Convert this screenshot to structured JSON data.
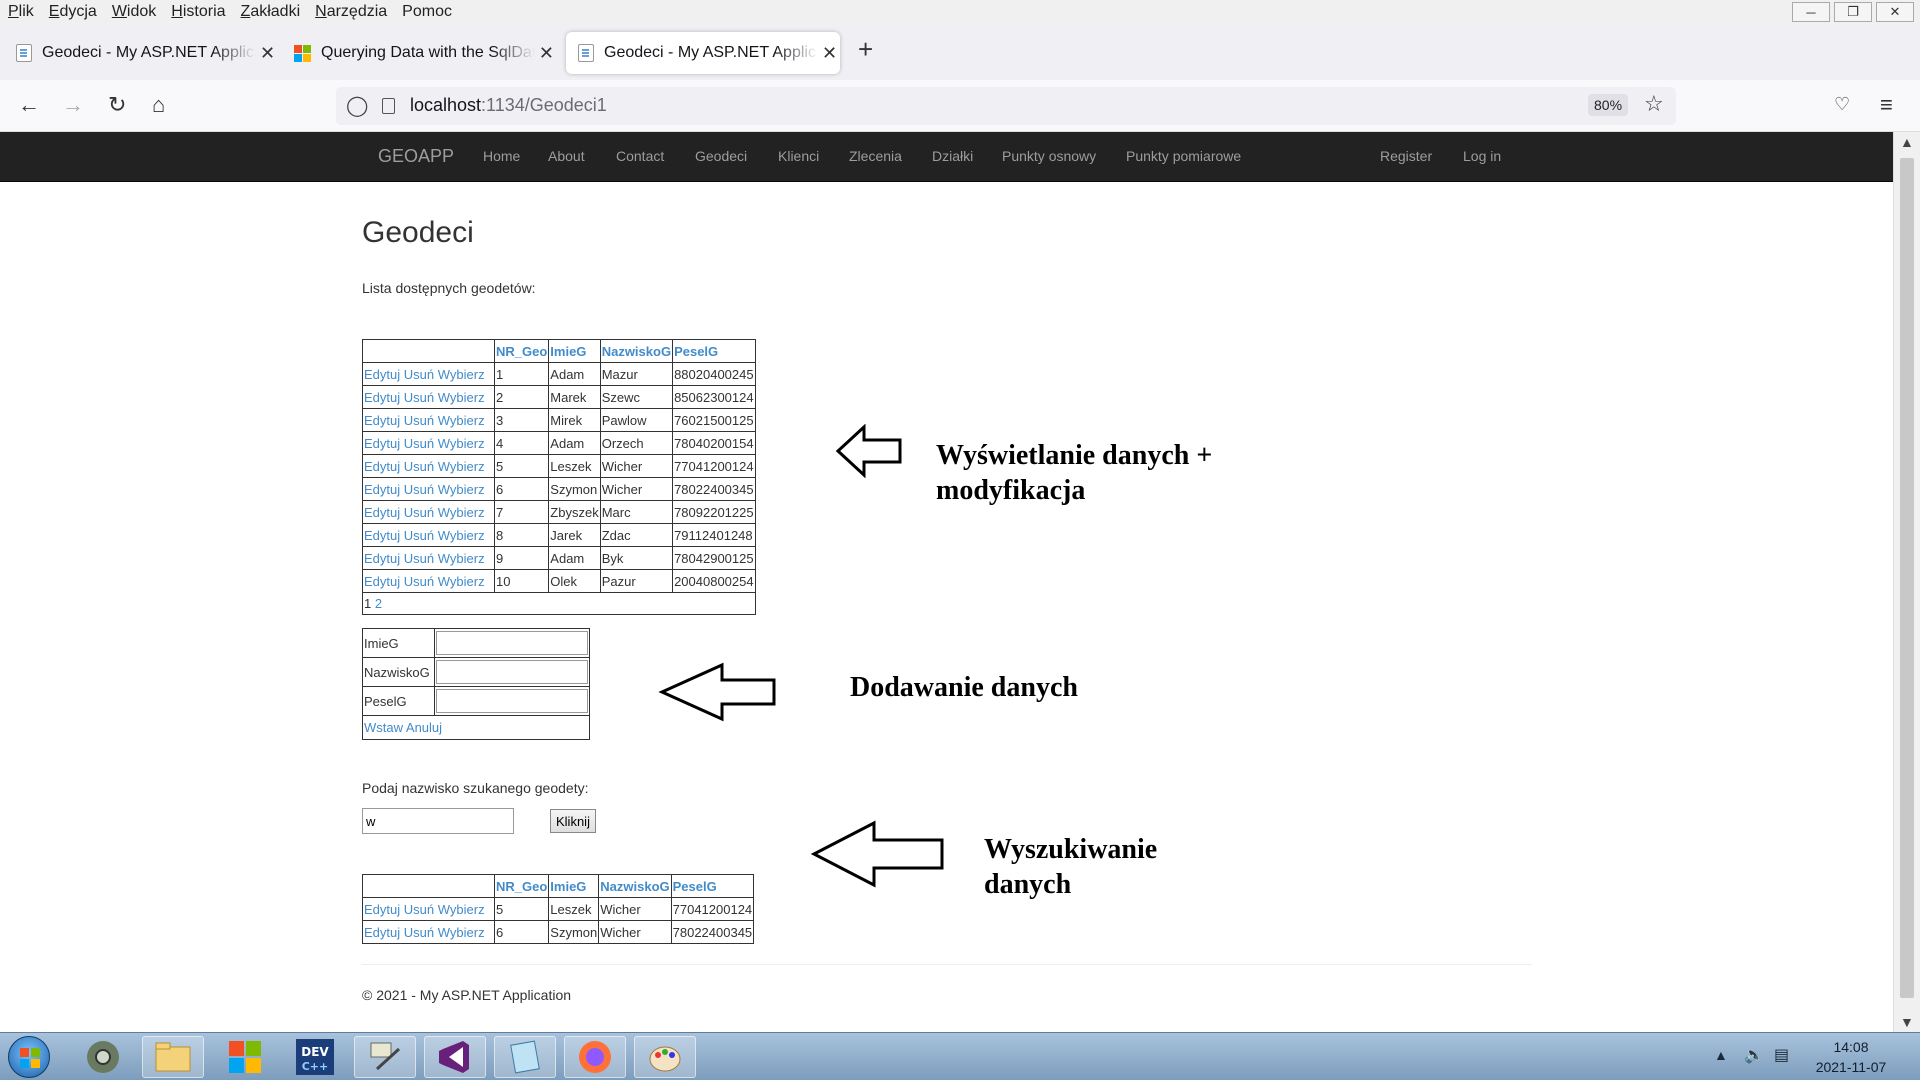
{
  "menubar": {
    "items": [
      {
        "u": "P",
        "rest": "lik"
      },
      {
        "u": "E",
        "rest": "dycja"
      },
      {
        "u": "W",
        "rest": "idok"
      },
      {
        "u": "H",
        "rest": "istoria"
      },
      {
        "u": "Z",
        "rest": "akładki"
      },
      {
        "u": "N",
        "rest": "arzędzia"
      },
      {
        "u": "",
        "rest": "Pomoc"
      }
    ]
  },
  "tabs": [
    {
      "title": "Geodeci - My ASP.NET Applicati",
      "icon": "page-icon",
      "active": false
    },
    {
      "title": "Querying Data with the SqlData",
      "icon": "microsoft-icon",
      "active": false
    },
    {
      "title": "Geodeci - My ASP.NET Applicati",
      "icon": "page-icon",
      "active": true
    }
  ],
  "urlbar": {
    "host": "localhost",
    "path": ":1134/Geodeci1",
    "zoom": "80%"
  },
  "site": {
    "brand": "GEOAPP",
    "nav": [
      "Home",
      "About",
      "Contact",
      "Geodeci",
      "Klienci",
      "Zlecenia",
      "Działki",
      "Punkty osnowy",
      "Punkty pomiarowe"
    ],
    "account": [
      "Register",
      "Log in"
    ]
  },
  "page": {
    "title": "Geodeci",
    "list_label": "Lista dostępnych geodetów:",
    "columns": [
      "NR_Geo",
      "ImieG",
      "NazwiskoG",
      "PeselG"
    ],
    "actions": [
      "Edytuj",
      "Usuń",
      "Wybierz"
    ],
    "rows": [
      [
        "1",
        "Adam",
        "Mazur",
        "88020400245"
      ],
      [
        "2",
        "Marek",
        "Szewc",
        "85062300124"
      ],
      [
        "3",
        "Mirek",
        "Pawlow",
        "76021500125"
      ],
      [
        "4",
        "Adam",
        "Orzech",
        "78040200154"
      ],
      [
        "5",
        "Leszek",
        "Wicher",
        "77041200124"
      ],
      [
        "6",
        "Szymon",
        "Wicher",
        "78022400345"
      ],
      [
        "7",
        "Zbyszek",
        "Marc",
        "78092201225"
      ],
      [
        "8",
        "Jarek",
        "Zdac",
        "79112401248"
      ],
      [
        "9",
        "Adam",
        "Byk",
        "78042900125"
      ],
      [
        "10",
        "Olek",
        "Pazur",
        "20040800254"
      ]
    ],
    "pager": {
      "current": "1",
      "other": "2"
    },
    "form": {
      "fields": [
        "ImieG",
        "NazwiskoG",
        "PeselG"
      ],
      "values": [
        "",
        "",
        ""
      ],
      "insert": "Wstaw",
      "cancel": "Anuluj"
    },
    "search": {
      "label": "Podaj nazwisko szukanego geodety:",
      "value": "w",
      "button": "Kliknij",
      "rows": [
        [
          "5",
          "Leszek",
          "Wicher",
          "77041200124"
        ],
        [
          "6",
          "Szymon",
          "Wicher",
          "78022400345"
        ]
      ]
    },
    "footer": "© 2021 - My ASP.NET Application"
  },
  "annotations": {
    "display_line1": "Wyświetlanie danych +",
    "display_line2": "modyfikacja",
    "add": "Dodawanie danych",
    "search_line1": "Wyszukiwanie",
    "search_line2": "danych"
  },
  "taskbar": {
    "time": "14:08",
    "date": "2021-11-07"
  },
  "colors": {
    "link": "#428bca",
    "navbar": "#222222",
    "navbar_text": "#9d9d9d"
  }
}
